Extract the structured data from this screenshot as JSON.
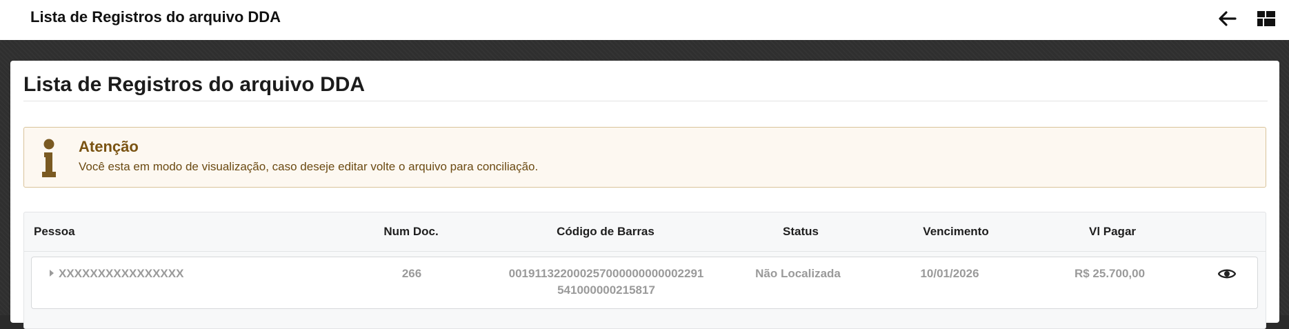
{
  "topbar": {
    "title": "Lista de Registros do arquivo DDA",
    "back_icon": "arrow-left-icon",
    "menu_icon": "grid-icon"
  },
  "card": {
    "title": "Lista de Registros do arquivo DDA"
  },
  "alert": {
    "icon": "info-icon",
    "title": "Atenção",
    "message": "Você esta em modo de visualização, caso deseje editar volte o arquivo para conciliação."
  },
  "table": {
    "headers": {
      "pessoa": "Pessoa",
      "num_doc": "Num Doc.",
      "codigo_barras": "Código de Barras",
      "status": "Status",
      "vencimento": "Vencimento",
      "vl_pagar": "Vl Pagar"
    },
    "rows": [
      {
        "pessoa": "XXXXXXXXXXXXXXXX",
        "num_doc": "266",
        "codigo_barras_line1": "001911322000257000000000002291",
        "codigo_barras_line2": "541000000215817",
        "status": "Não Localizada",
        "vencimento": "10/01/2026",
        "vl_pagar": "R$ 25.700,00",
        "action_icon": "eye-icon"
      }
    ]
  },
  "colors": {
    "topbar_bg": "#ffffff",
    "page_bg": "#2f2f2f",
    "alert_bg": "#fdf8f1",
    "alert_border": "#d9c39a",
    "alert_text": "#7a5312",
    "muted_text": "#9a9a9a"
  }
}
